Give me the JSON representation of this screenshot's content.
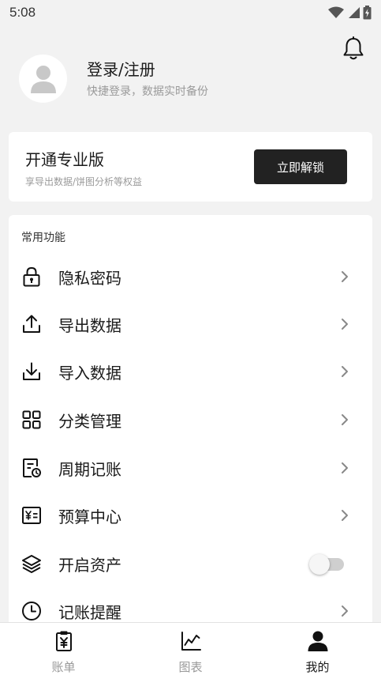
{
  "status_bar": {
    "time": "5:08"
  },
  "profile": {
    "title": "登录/注册",
    "subtitle": "快捷登录，数据实时备份"
  },
  "pro_card": {
    "title": "开通专业版",
    "subtitle": "享导出数据/饼图分析等权益",
    "button_label": "立即解锁"
  },
  "functions": {
    "header": "常用功能",
    "items": [
      {
        "label": "隐私密码",
        "icon": "lock-icon",
        "control": "chevron"
      },
      {
        "label": "导出数据",
        "icon": "upload-icon",
        "control": "chevron"
      },
      {
        "label": "导入数据",
        "icon": "download-icon",
        "control": "chevron"
      },
      {
        "label": "分类管理",
        "icon": "grid-icon",
        "control": "chevron"
      },
      {
        "label": "周期记账",
        "icon": "recurring-bill-icon",
        "control": "chevron"
      },
      {
        "label": "预算中心",
        "icon": "budget-icon",
        "control": "chevron"
      },
      {
        "label": "开启资产",
        "icon": "layers-icon",
        "control": "toggle",
        "enabled": false
      },
      {
        "label": "记账提醒",
        "icon": "clock-icon",
        "control": "chevron"
      }
    ]
  },
  "bottom_nav": {
    "items": [
      {
        "label": "账单",
        "icon": "bill-icon",
        "active": false
      },
      {
        "label": "图表",
        "icon": "chart-icon",
        "active": false
      },
      {
        "label": "我的",
        "icon": "person-icon",
        "active": true
      }
    ]
  },
  "colors": {
    "background": "#f2f2f2",
    "card": "#ffffff",
    "button_dark": "#222222",
    "text_primary": "#1a1a1a",
    "text_secondary": "#9a9a9a"
  }
}
